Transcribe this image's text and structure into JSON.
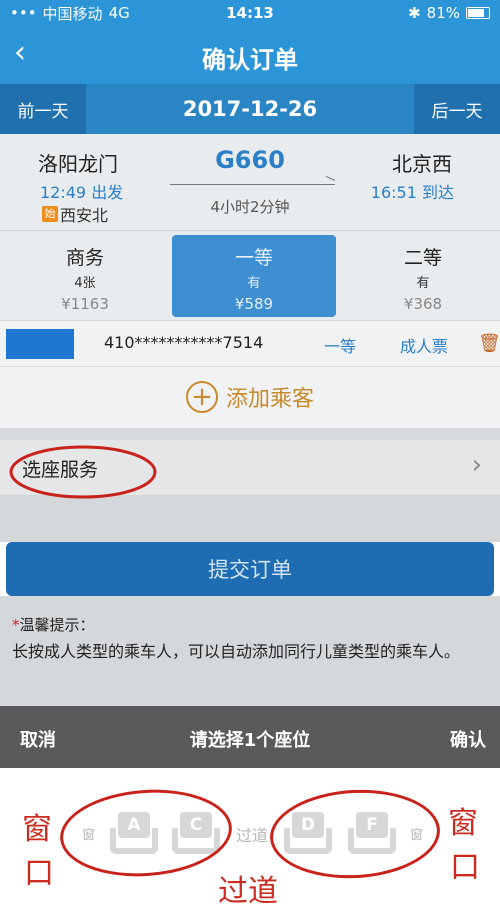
{
  "status": {
    "carrier": "中国移动",
    "network": "4G",
    "time": "14:13",
    "bluetooth": "✱",
    "battery": "81%"
  },
  "nav": {
    "back": "‹",
    "title": "确认订单"
  },
  "datebar": {
    "prev": "前一天",
    "date": "2017-12-26",
    "next": "后一天"
  },
  "train": {
    "from": "洛阳龙门",
    "from_time": "12:49 出发",
    "from_station_badge": "始",
    "from_station": "西安北",
    "number": "G660",
    "duration": "4小时2分钟",
    "to": "北京西",
    "to_time": "16:51 到达"
  },
  "seat_classes": [
    {
      "name": "商务",
      "count": "4张",
      "price": "¥1163"
    },
    {
      "name": "一等",
      "count": "有",
      "price": "¥589"
    },
    {
      "name": "二等",
      "count": "有",
      "price": "¥368"
    }
  ],
  "passenger": {
    "id": "410***********7514",
    "seat_class": "一等",
    "ticket_type": "成人票"
  },
  "add_passenger": {
    "plus": "+",
    "label": "添加乘客"
  },
  "seat_service": {
    "label": "选座服务",
    "chevron": "›"
  },
  "submit": {
    "label": "提交订单"
  },
  "tips": {
    "star": "*",
    "title": "温馨提示：",
    "body": "长按成人类型的乘车人，可以自动添加同行儿童类型的乘车人。"
  },
  "picker": {
    "cancel": "取消",
    "title": "请选择1个座位",
    "confirm": "确认"
  },
  "seatmap": {
    "window_left": "窗",
    "window_right": "窗",
    "aisle": "过道",
    "seats": [
      "A",
      "C",
      "D",
      "F"
    ]
  },
  "annotations": {
    "left": [
      "窗",
      "口"
    ],
    "right": [
      "窗",
      "口"
    ],
    "bottom": "过道"
  },
  "colors": {
    "primary": "#2c95d8",
    "accent": "#2a7fc7",
    "annotation": "#c8221a"
  }
}
